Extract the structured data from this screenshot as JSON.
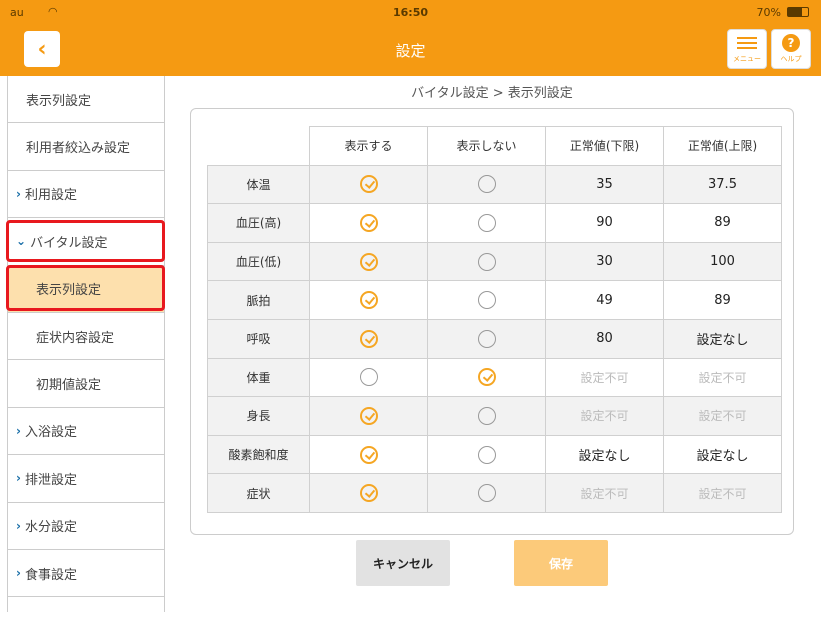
{
  "status_bar": {
    "carrier": "au",
    "time": "16:50",
    "battery": "70%"
  },
  "header": {
    "title": "設定",
    "back_icon": "chevron-left-icon",
    "menu_label": "メニュー",
    "help_label": "ヘルプ",
    "help_glyph": "?"
  },
  "sidebar": {
    "items": [
      {
        "label": "表示列設定"
      },
      {
        "label": "利用者絞込み設定"
      },
      {
        "label": "利用設定"
      },
      {
        "label": "バイタル設定"
      },
      {
        "label": "表示列設定"
      },
      {
        "label": "症状内容設定"
      },
      {
        "label": "初期値設定"
      },
      {
        "label": "入浴設定"
      },
      {
        "label": "排泄設定"
      },
      {
        "label": "水分設定"
      },
      {
        "label": "食事設定"
      }
    ]
  },
  "breadcrumb": "バイタル設定 > 表示列設定",
  "table": {
    "headers": [
      "表示する",
      "表示しない",
      "正常値(下限)",
      "正常値(上限)"
    ],
    "rows": [
      {
        "label": "体温",
        "show": true,
        "lower": "35",
        "upper": "37.5",
        "na": false
      },
      {
        "label": "血圧(高)",
        "show": true,
        "lower": "90",
        "upper": "89",
        "na": false
      },
      {
        "label": "血圧(低)",
        "show": true,
        "lower": "30",
        "upper": "100",
        "na": false
      },
      {
        "label": "脈拍",
        "show": true,
        "lower": "49",
        "upper": "89",
        "na": false
      },
      {
        "label": "呼吸",
        "show": true,
        "lower": "80",
        "upper": "設定なし",
        "na": false
      },
      {
        "label": "体重",
        "show": false,
        "lower": "設定不可",
        "upper": "設定不可",
        "na": true
      },
      {
        "label": "身長",
        "show": true,
        "lower": "設定不可",
        "upper": "設定不可",
        "na": true
      },
      {
        "label": "酸素飽和度",
        "show": true,
        "lower": "設定なし",
        "upper": "設定なし",
        "na": false
      },
      {
        "label": "症状",
        "show": true,
        "lower": "設定不可",
        "upper": "設定不可",
        "na": true
      }
    ]
  },
  "buttons": {
    "cancel": "キャンセル",
    "save": "保存"
  },
  "colors": {
    "accent": "#f59a12",
    "highlight": "#e8181e",
    "active_bg": "#fde0ad",
    "check": "#f5a623"
  }
}
